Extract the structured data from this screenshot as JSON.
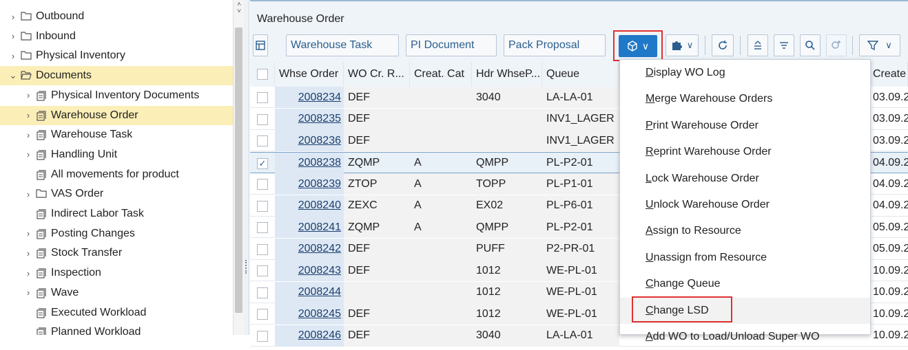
{
  "tree": {
    "items": [
      {
        "label": "Outbound",
        "chevron": "›",
        "icon": "folder-icon",
        "indent": 0
      },
      {
        "label": "Inbound",
        "chevron": "›",
        "icon": "folder-icon",
        "indent": 0
      },
      {
        "label": "Physical Inventory",
        "chevron": "›",
        "icon": "folder-icon",
        "indent": 0
      },
      {
        "label": "Documents",
        "chevron": "⌄",
        "icon": "folder-open-icon",
        "indent": 0,
        "selected": true
      },
      {
        "label": "Physical Inventory Documents",
        "chevron": "›",
        "icon": "document-stack-icon",
        "indent": 1
      },
      {
        "label": "Warehouse Order",
        "chevron": "›",
        "icon": "document-stack-icon",
        "indent": 1,
        "selected": true
      },
      {
        "label": "Warehouse Task",
        "chevron": "›",
        "icon": "document-stack-icon",
        "indent": 1
      },
      {
        "label": "Handling Unit",
        "chevron": "›",
        "icon": "document-stack-icon",
        "indent": 1
      },
      {
        "label": "All movements for product",
        "chevron": "",
        "icon": "document-stack-icon",
        "indent": 1
      },
      {
        "label": "VAS Order",
        "chevron": "›",
        "icon": "folder-icon",
        "indent": 1
      },
      {
        "label": "Indirect Labor Task",
        "chevron": "",
        "icon": "document-stack-icon",
        "indent": 1
      },
      {
        "label": "Posting Changes",
        "chevron": "›",
        "icon": "document-stack-icon",
        "indent": 1
      },
      {
        "label": "Stock Transfer",
        "chevron": "›",
        "icon": "document-stack-icon",
        "indent": 1
      },
      {
        "label": "Inspection",
        "chevron": "›",
        "icon": "document-stack-icon",
        "indent": 1
      },
      {
        "label": "Wave",
        "chevron": "›",
        "icon": "document-stack-icon",
        "indent": 1
      },
      {
        "label": "Executed Workload",
        "chevron": "",
        "icon": "document-stack-icon",
        "indent": 1
      },
      {
        "label": "Planned Workload",
        "chevron": "",
        "icon": "document-stack-icon",
        "indent": 1
      }
    ]
  },
  "header": {
    "title": "Warehouse Order"
  },
  "toolbar": {
    "tab1": "Warehouse Task",
    "tab2": "PI Document",
    "tab3": "Pack Proposal",
    "more_icon": "cube-icon",
    "chevron": "∨"
  },
  "table": {
    "columns": [
      "Whse Order",
      "WO Cr. R...",
      "Creat. Cat",
      "Hdr WhseP...",
      "Queue",
      "Create"
    ],
    "rows": [
      {
        "order": "2008234",
        "wocr": "DEF",
        "cat": "",
        "hdr": "3040",
        "queue": "LA-LA-01",
        "created": "03.09.2",
        "checked": false
      },
      {
        "order": "2008235",
        "wocr": "DEF",
        "cat": "",
        "hdr": "",
        "queue": "INV1_LAGER",
        "created": "03.09.2",
        "checked": false
      },
      {
        "order": "2008236",
        "wocr": "DEF",
        "cat": "",
        "hdr": "",
        "queue": "INV1_LAGER",
        "created": "03.09.2",
        "checked": false
      },
      {
        "order": "2008238",
        "wocr": "ZQMP",
        "cat": "A",
        "hdr": "QMPP",
        "queue": "PL-P2-01",
        "created": "04.09.2",
        "checked": true
      },
      {
        "order": "2008239",
        "wocr": "ZTOP",
        "cat": "A",
        "hdr": "TOPP",
        "queue": "PL-P1-01",
        "created": "04.09.2",
        "checked": false
      },
      {
        "order": "2008240",
        "wocr": "ZEXC",
        "cat": "A",
        "hdr": "EX02",
        "queue": "PL-P6-01",
        "created": "04.09.2",
        "checked": false
      },
      {
        "order": "2008241",
        "wocr": "ZQMP",
        "cat": "A",
        "hdr": "QMPP",
        "queue": "PL-P2-01",
        "created": "05.09.2",
        "checked": false
      },
      {
        "order": "2008242",
        "wocr": "DEF",
        "cat": "",
        "hdr": "PUFF",
        "queue": "P2-PR-01",
        "created": "05.09.2",
        "checked": false
      },
      {
        "order": "2008243",
        "wocr": "DEF",
        "cat": "",
        "hdr": "1012",
        "queue": "WE-PL-01",
        "created": "10.09.2",
        "checked": false
      },
      {
        "order": "2008244",
        "wocr": "",
        "cat": "",
        "hdr": "1012",
        "queue": "WE-PL-01",
        "created": "10.09.2",
        "checked": false
      },
      {
        "order": "2008245",
        "wocr": "DEF",
        "cat": "",
        "hdr": "1012",
        "queue": "WE-PL-01",
        "created": "10.09.2",
        "checked": false
      },
      {
        "order": "2008246",
        "wocr": "DEF",
        "cat": "",
        "hdr": "3040",
        "queue": "LA-LA-01",
        "created": "10.09.2",
        "checked": false
      }
    ]
  },
  "menu": {
    "items": [
      {
        "label": "Display WO Log",
        "u": "D",
        "rest": "isplay WO Log"
      },
      {
        "label": "Merge Warehouse Orders",
        "u": "M",
        "rest": "erge Warehouse Orders"
      },
      {
        "label": "Print Warehouse Order",
        "u": "P",
        "rest": "rint Warehouse Order"
      },
      {
        "label": "Reprint Warehouse Order",
        "u": "R",
        "rest": "eprint Warehouse Order"
      },
      {
        "label": "Lock Warehouse Order",
        "u": "L",
        "rest": "ock Warehouse Order"
      },
      {
        "label": "Unlock Warehouse Order",
        "u": "U",
        "rest": "nlock Warehouse Order"
      },
      {
        "label": "Assign to Resource",
        "u": "A",
        "rest": "ssign to Resource"
      },
      {
        "label": "Unassign from Resource",
        "u": "U",
        "rest": "nassign from Resource"
      },
      {
        "label": "Change Queue",
        "u": "C",
        "rest": "hange Queue"
      },
      {
        "label": "Change LSD",
        "u": "C",
        "rest": "hange LSD",
        "highlighted": true
      },
      {
        "label": "Add WO to Load/Unload Super WO",
        "u": "A",
        "rest": "dd WO to Load/Unload Super WO"
      }
    ]
  },
  "colors": {
    "accent": "#1f78c8",
    "highlight_border": "#e03030",
    "selected_tree": "#fbeeb7"
  }
}
